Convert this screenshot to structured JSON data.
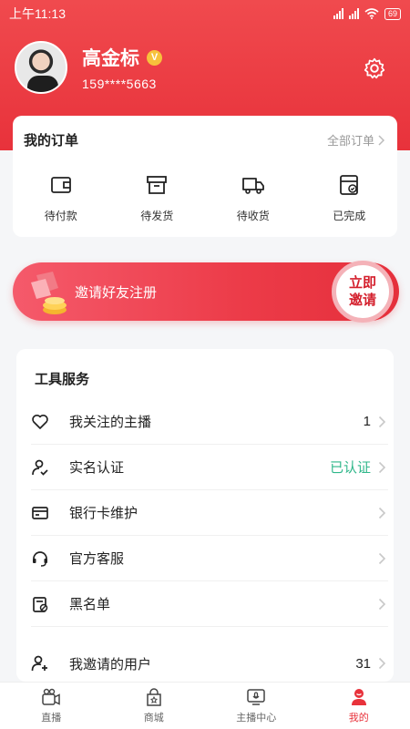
{
  "status_bar": {
    "time": "上午11:13",
    "battery": "69"
  },
  "profile": {
    "name": "高金标",
    "vip_badge": "V",
    "phone": "159****5663"
  },
  "orders": {
    "title": "我的订单",
    "all_label": "全部订单",
    "items": [
      {
        "label": "待付款",
        "icon": "wallet-icon"
      },
      {
        "label": "待发货",
        "icon": "box-icon"
      },
      {
        "label": "待收货",
        "icon": "truck-icon"
      },
      {
        "label": "已完成",
        "icon": "completed-icon"
      }
    ]
  },
  "invite": {
    "text": "邀请好友注册",
    "button_line1": "立即",
    "button_line2": "邀请"
  },
  "tools": {
    "title": "工具服务",
    "items": [
      {
        "label": "我关注的主播",
        "value": "1",
        "icon": "heart-icon"
      },
      {
        "label": "实名认证",
        "value": "已认证",
        "icon": "verified-user-icon"
      },
      {
        "label": "银行卡维护",
        "value": "",
        "icon": "bank-card-icon"
      },
      {
        "label": "官方客服",
        "value": "",
        "icon": "headset-icon"
      },
      {
        "label": "黑名单",
        "value": "",
        "icon": "blacklist-icon"
      },
      {
        "label": "我邀请的用户",
        "value": "31",
        "icon": "add-user-icon"
      }
    ]
  },
  "tabbar": {
    "items": [
      {
        "label": "直播",
        "icon": "live-camera-icon"
      },
      {
        "label": "商城",
        "icon": "shop-icon"
      },
      {
        "label": "主播中心",
        "icon": "anchor-center-icon"
      },
      {
        "label": "我的",
        "icon": "me-icon"
      }
    ],
    "active_index": 3
  },
  "colors": {
    "brand": "#e8323b",
    "verified": "#2fb78a",
    "vip": "#f7c23c"
  }
}
